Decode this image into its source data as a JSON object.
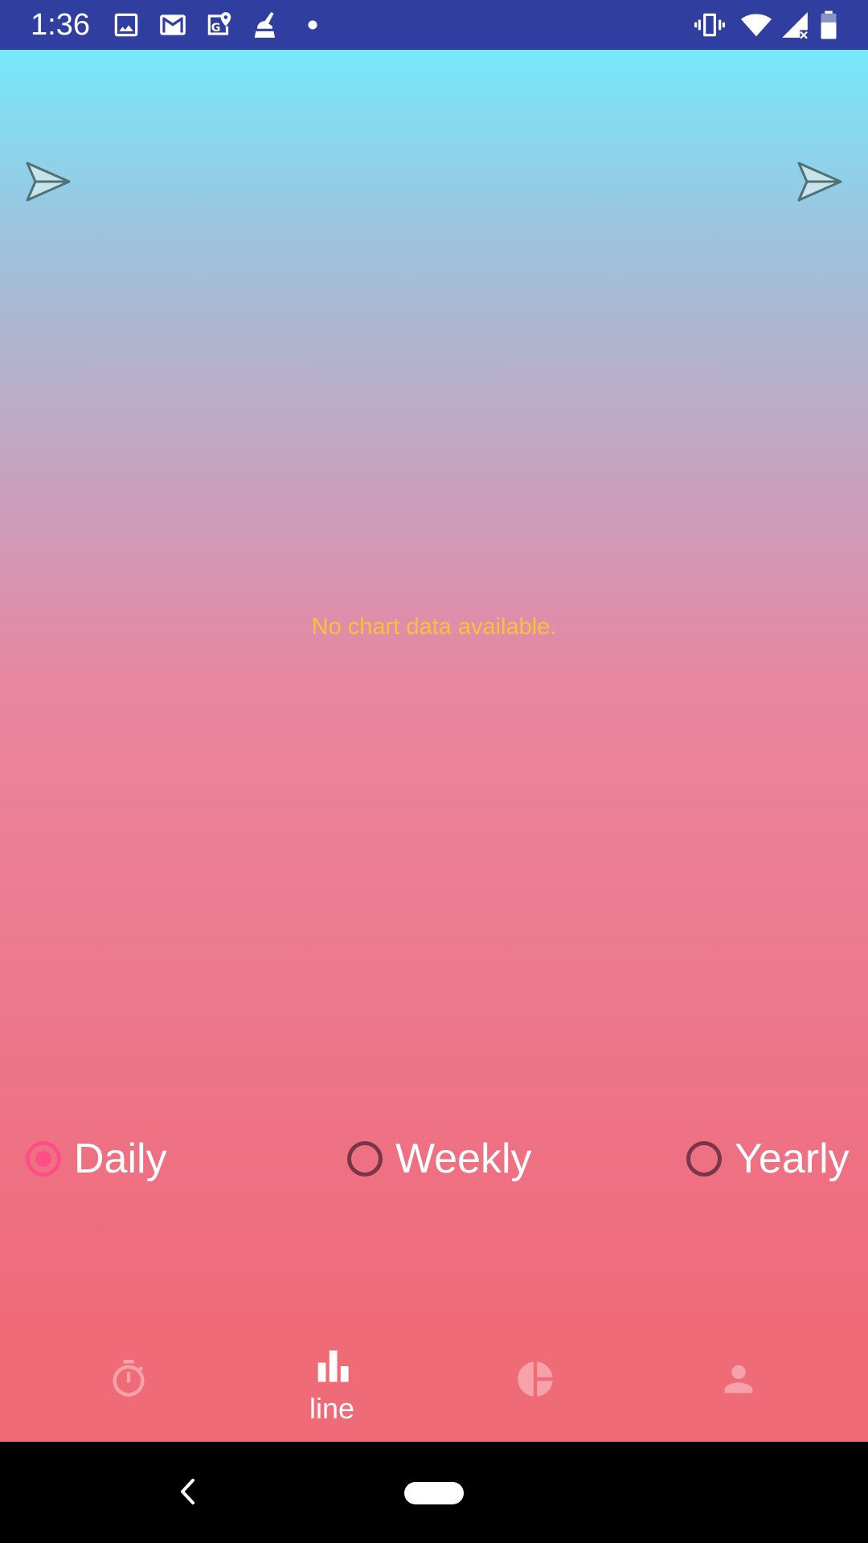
{
  "status_bar": {
    "time": "1:36",
    "background_color": "#303f9f",
    "left_icons": [
      "image-icon",
      "gmail-icon",
      "maps-icon",
      "cleaner-icon",
      "dot-icon"
    ],
    "right_icons": [
      "vibrate-icon",
      "wifi-icon",
      "signal-icon",
      "battery-icon"
    ]
  },
  "main": {
    "empty_message": "No chart data available.",
    "empty_message_color": "#f6c23c",
    "left_icon": "send-icon",
    "right_icon": "send-icon",
    "gradient_top": "#78e8fc",
    "gradient_bottom": "#ef6b7a"
  },
  "period_selector": {
    "options": [
      {
        "label": "Daily",
        "checked": true
      },
      {
        "label": "Weekly",
        "checked": false
      },
      {
        "label": "Yearly",
        "checked": false
      }
    ],
    "accent_color": "#ff4d88"
  },
  "bottom_nav": {
    "items": [
      {
        "icon": "stopwatch-icon",
        "label": "",
        "active": false
      },
      {
        "icon": "bar-chart-icon",
        "label": "line",
        "active": true
      },
      {
        "icon": "pie-chart-icon",
        "label": "",
        "active": false
      },
      {
        "icon": "person-icon",
        "label": "",
        "active": false
      }
    ],
    "background_color": "#f06b78"
  },
  "system_nav": {
    "icons": [
      "back-icon",
      "home-pill-icon"
    ]
  }
}
